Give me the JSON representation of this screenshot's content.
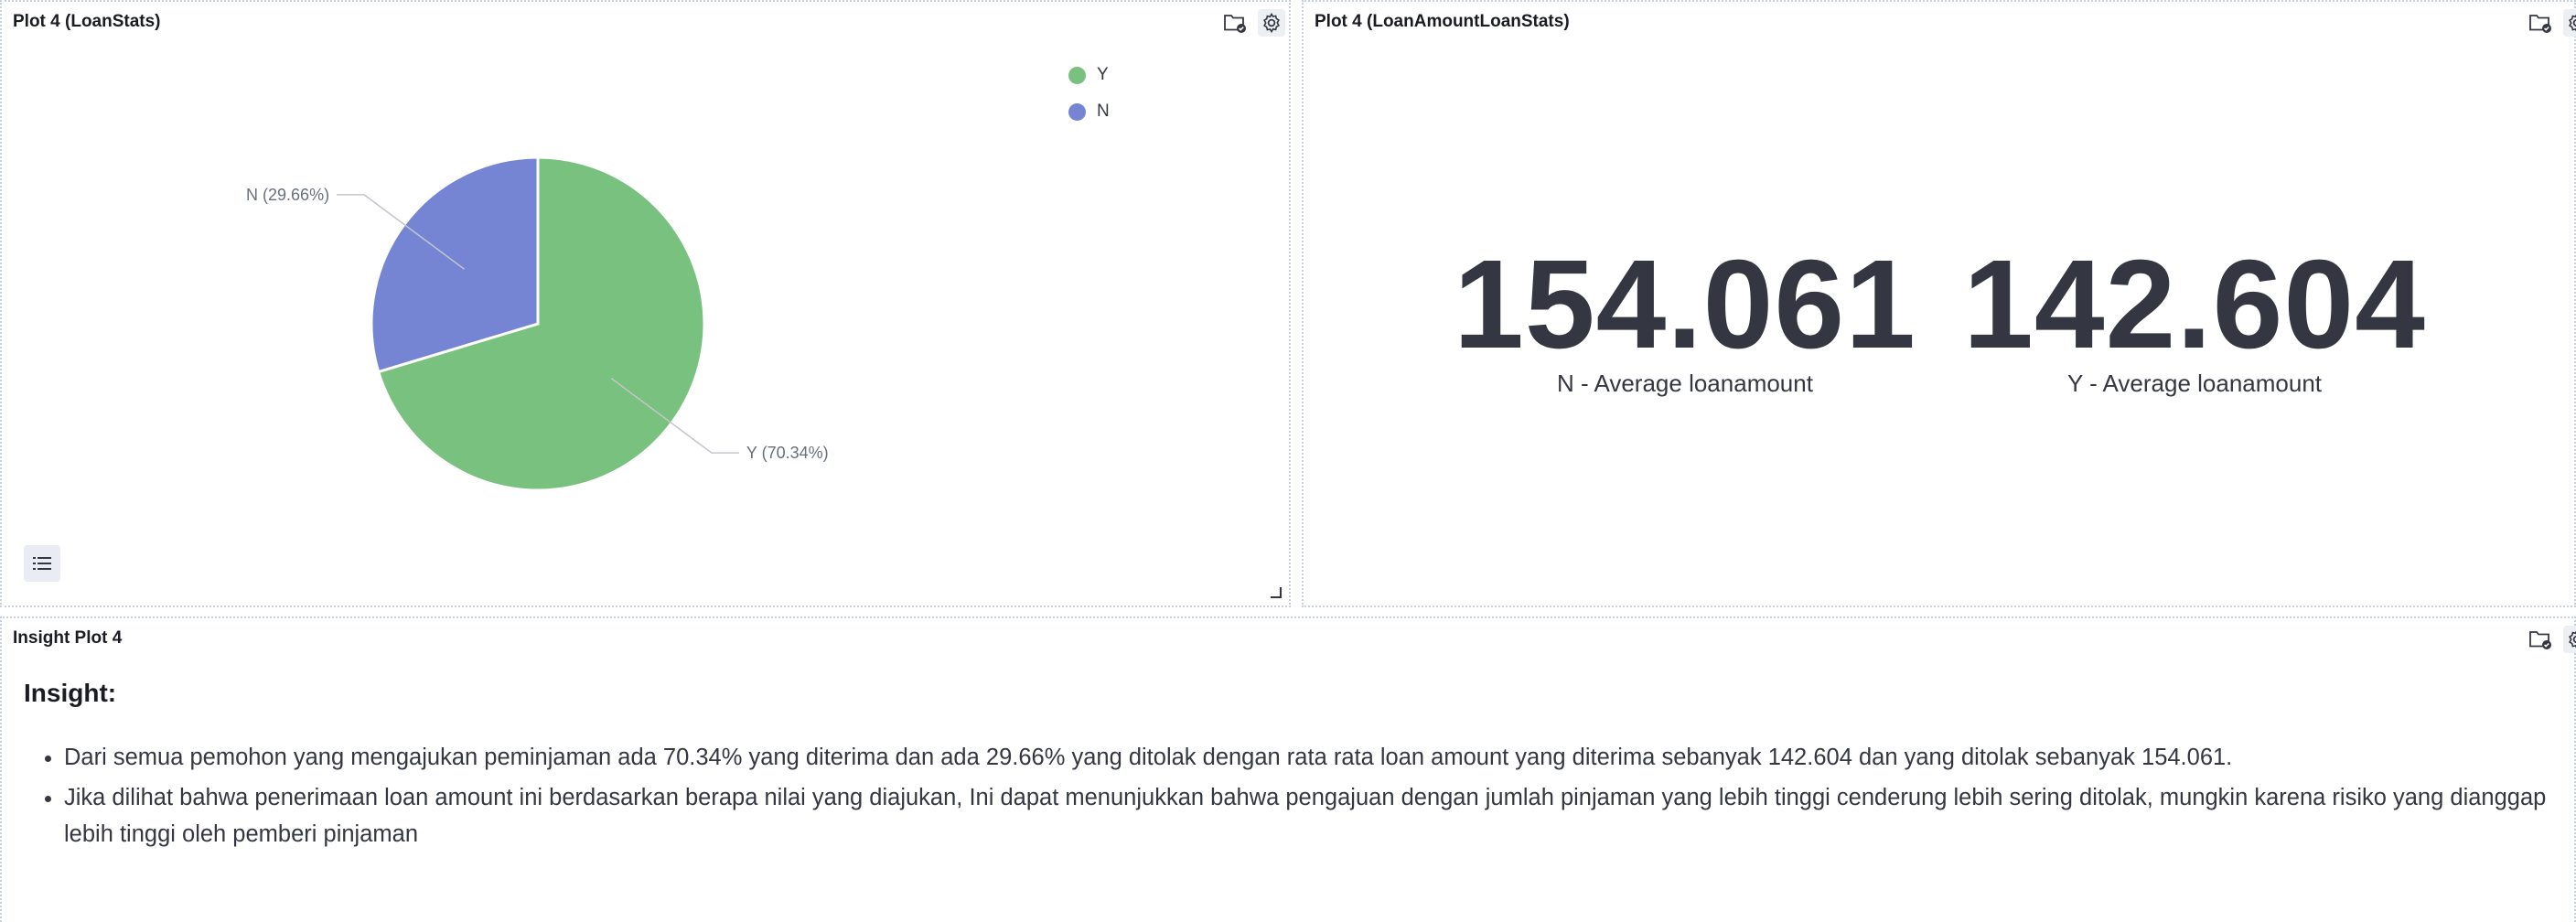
{
  "panels": {
    "loanstats": {
      "title": "Plot 4 (LoanStats)"
    },
    "loanamount": {
      "title": "Plot 4 (LoanAmountLoanStats)"
    },
    "insight": {
      "title": "Insight Plot 4"
    }
  },
  "icons": {
    "folder": "folder-check-icon",
    "gear": "gear-icon",
    "list": "list-icon",
    "resize": "resize-handle-icon"
  },
  "chart_data": {
    "type": "pie",
    "categories": [
      "Y",
      "N"
    ],
    "values": [
      70.34,
      29.66
    ],
    "labels": [
      "Y (70.34%)",
      "N (29.66%)"
    ],
    "colors": [
      "#79c17f",
      "#7585d4"
    ],
    "legend": {
      "position": "top-right",
      "items": [
        "Y",
        "N"
      ]
    }
  },
  "metrics": [
    {
      "value": "154.061",
      "label": "N - Average loanamount"
    },
    {
      "value": "142.604",
      "label": "Y - Average loanamount"
    }
  ],
  "insight": {
    "heading": "Insight:",
    "bullets": [
      "Dari semua pemohon yang mengajukan peminjaman ada 70.34% yang diterima dan ada 29.66% yang ditolak dengan rata rata loan amount yang diterima sebanyak 142.604 dan yang ditolak sebanyak 154.061.",
      "Jika dilihat bahwa penerimaan loan amount ini berdasarkan berapa nilai yang diajukan, Ini dapat menunjukkan bahwa pengajuan dengan jumlah pinjaman yang lebih tinggi cenderung lebih sering ditolak, mungkin karena risiko yang dianggap lebih tinggi oleh pemberi pinjaman"
    ]
  }
}
